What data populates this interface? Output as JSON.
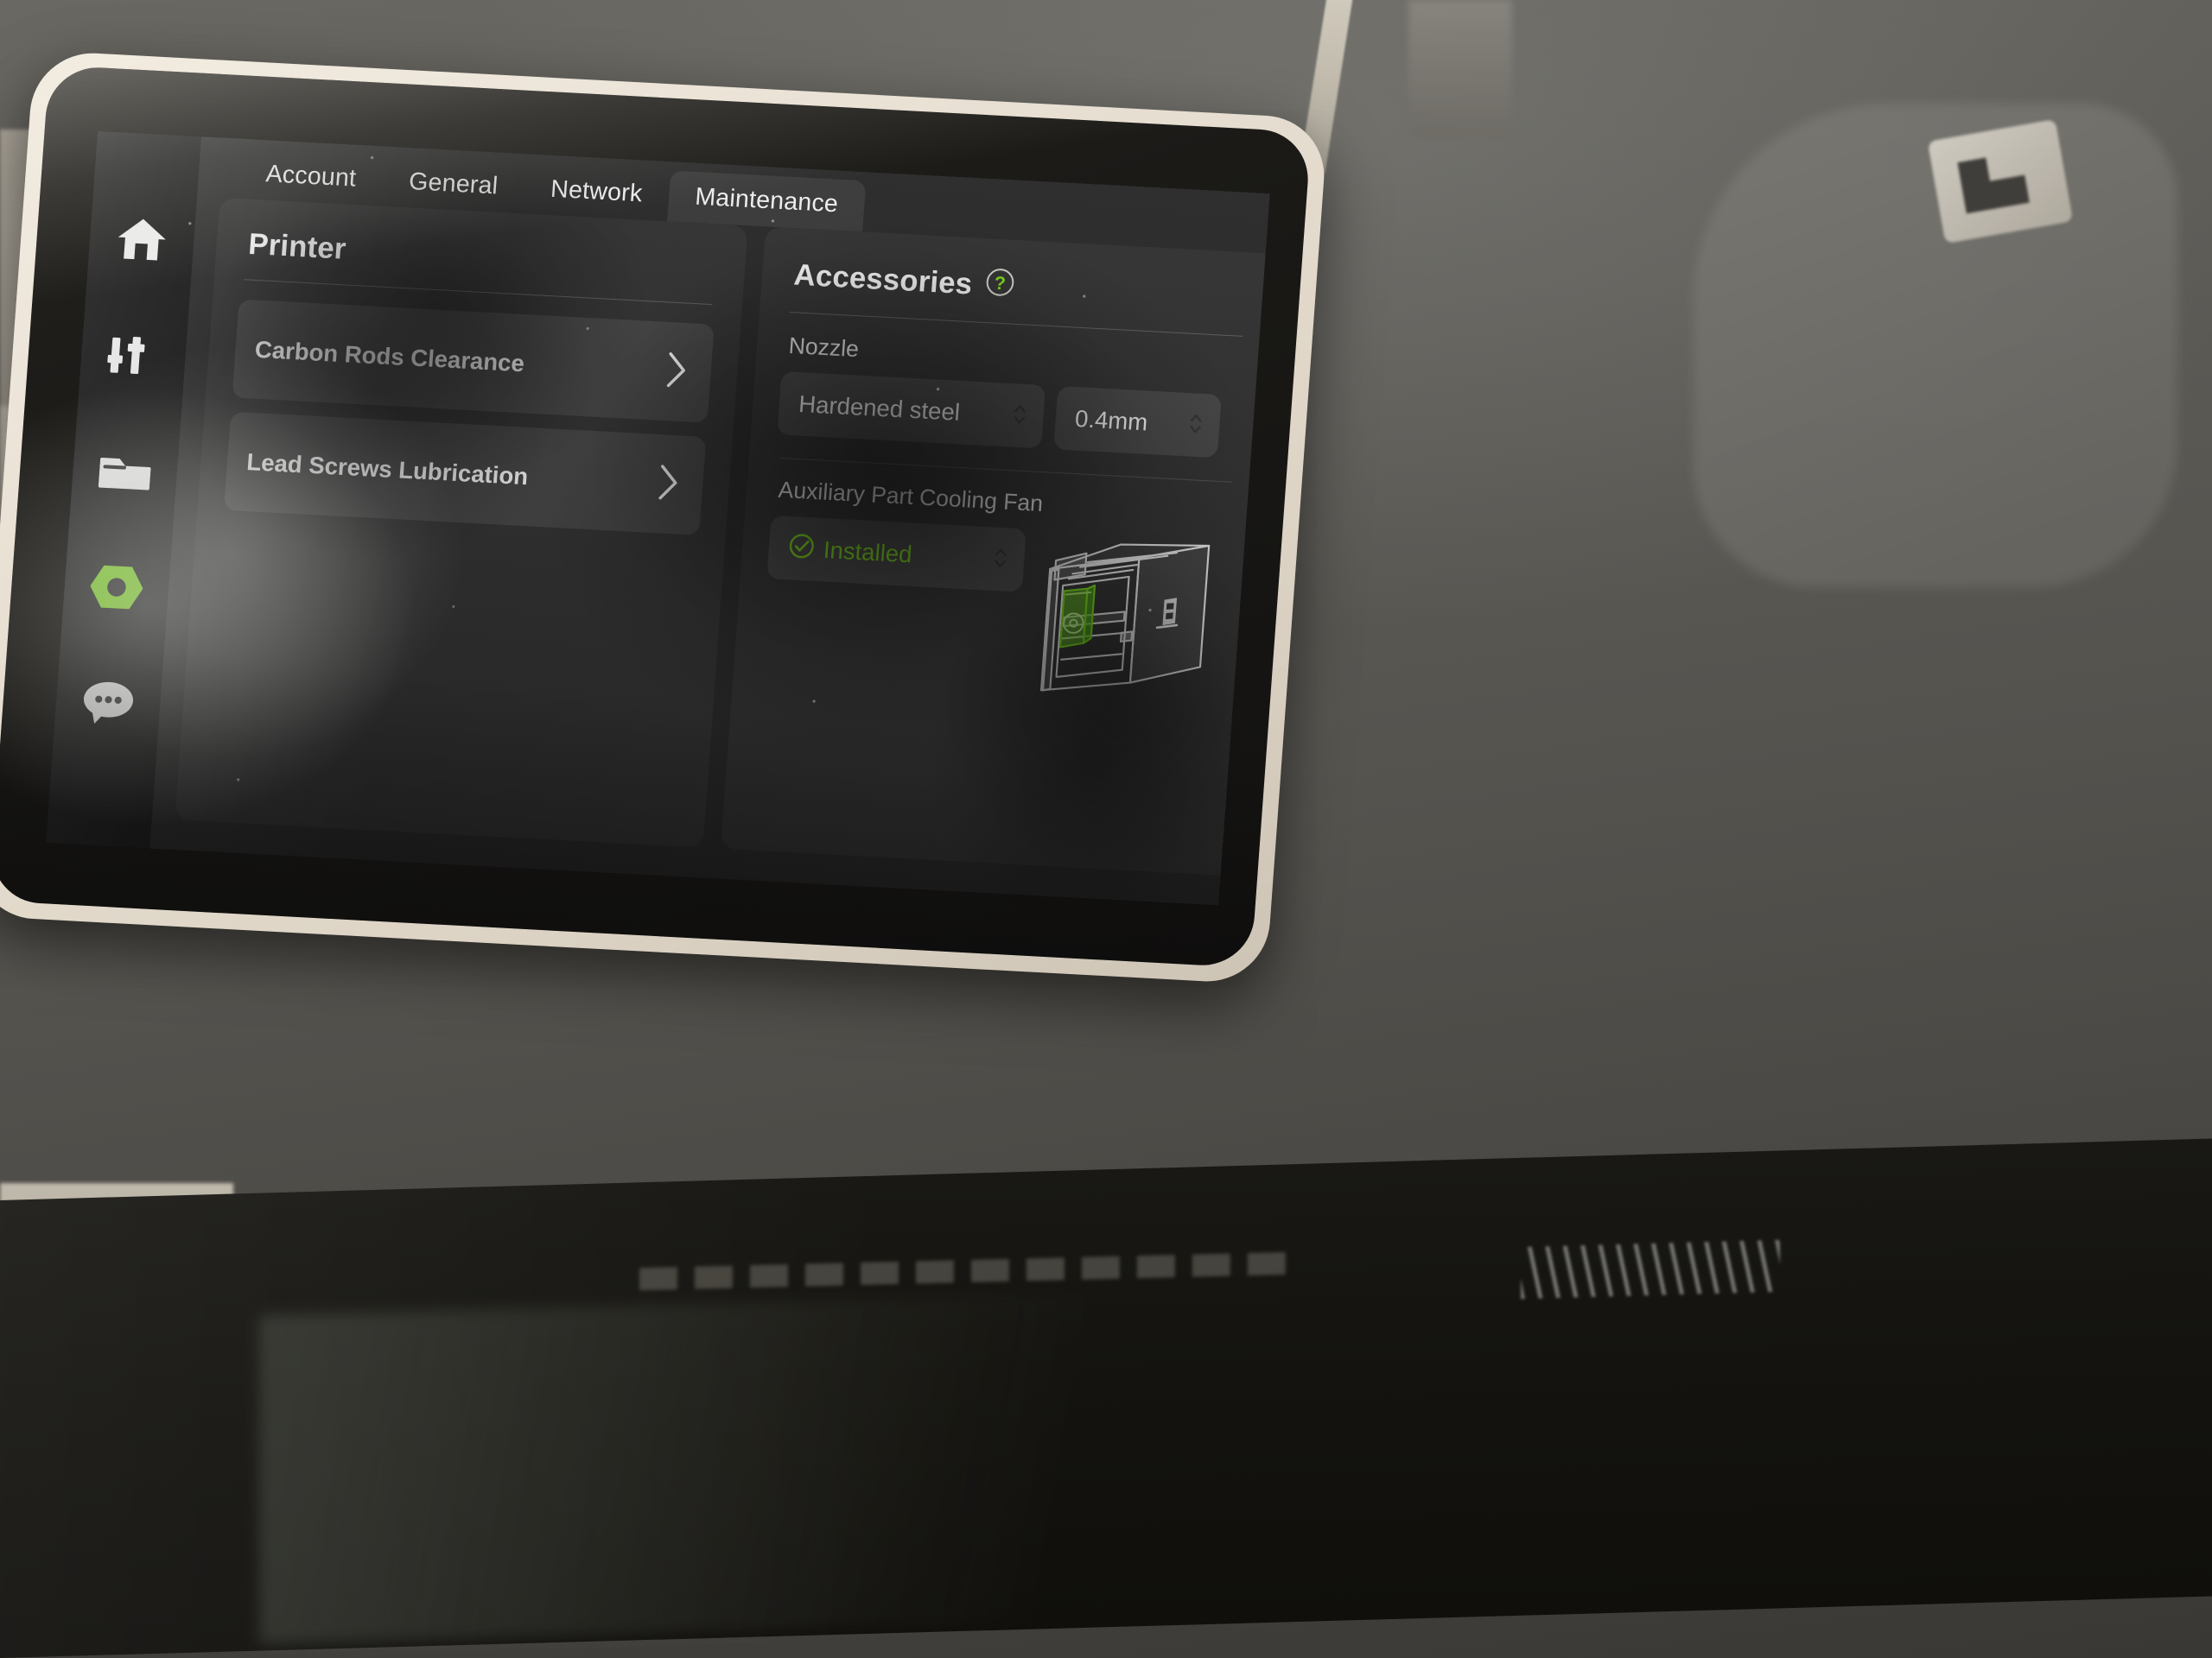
{
  "device": {
    "kind": "3d-printer-touchscreen",
    "bezel_color": "#e9e1d4",
    "screen_bg": "#2b2b2b"
  },
  "theme": {
    "accent_green": "#82e01f",
    "panel_bg": "#343434",
    "row_bg": "#474747",
    "tab_active_bg": "#3b3b3b",
    "text": "#ffffff"
  },
  "sidebar": {
    "items": [
      {
        "icon": "home-icon",
        "active": false
      },
      {
        "icon": "tune-sliders-icon",
        "active": false
      },
      {
        "icon": "folder-icon",
        "active": false
      },
      {
        "icon": "hex-nut-settings-icon",
        "active": true
      },
      {
        "icon": "chat-bubble-icon",
        "active": false
      }
    ]
  },
  "tabs": [
    {
      "label": "Account",
      "active": false
    },
    {
      "label": "General",
      "active": false
    },
    {
      "label": "Network",
      "active": false
    },
    {
      "label": "Maintenance",
      "active": true
    }
  ],
  "printer_panel": {
    "title": "Printer",
    "rows": [
      {
        "label": "Carbon Rods Clearance",
        "icon": "chevron-right-icon"
      },
      {
        "label": "Lead Screws Lubrication",
        "icon": "chevron-right-icon"
      }
    ]
  },
  "accessories_panel": {
    "title": "Accessories",
    "help_icon": "question-mark-circle-icon",
    "nozzle": {
      "label": "Nozzle",
      "material_value": "Hardened steel",
      "size_value": "0.4mm",
      "stepper_icon": "chevron-up-down-icon"
    },
    "aux_fan": {
      "label": "Auxiliary Part Cooling Fan",
      "status_value": "Installed",
      "status_icon": "check-circle-icon",
      "stepper_icon": "chevron-up-down-icon",
      "illustration": "printer-enclosure-line-art"
    }
  }
}
